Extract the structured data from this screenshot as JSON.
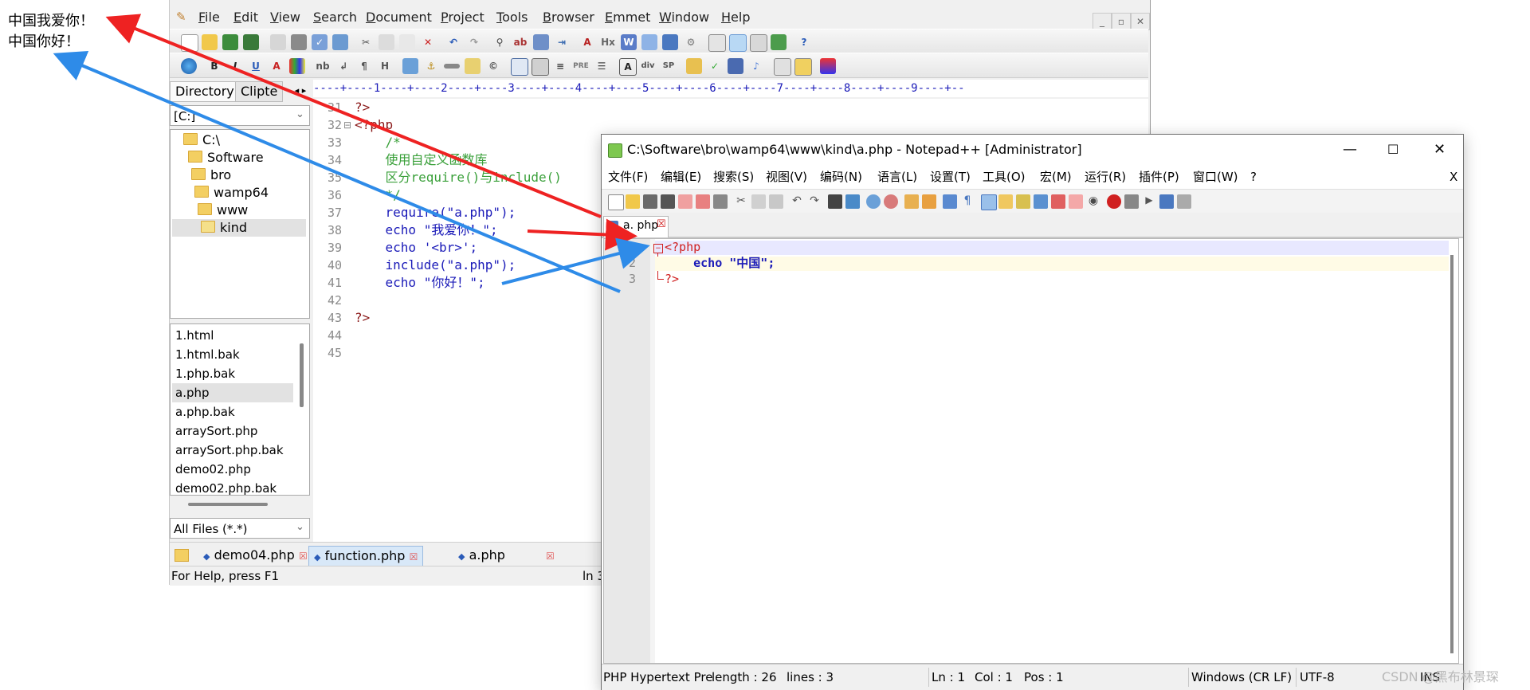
{
  "output": {
    "line1": "中国我爱你！",
    "line2": "中国你好！"
  },
  "back_window": {
    "menu": [
      "File",
      "Edit",
      "View",
      "Search",
      "Document",
      "Project",
      "Tools",
      "Browser",
      "Emmet",
      "Window",
      "Help"
    ],
    "window_controls": [
      "_",
      "▫",
      "✕"
    ],
    "panel_tabs": [
      "Directory",
      "Clipte"
    ],
    "drive": "[C:]",
    "tree": [
      "C:\\",
      "Software",
      "bro",
      "wamp64",
      "www",
      "kind"
    ],
    "files": [
      "1.html",
      "1.html.bak",
      "1.php.bak",
      "a.php",
      "a.php.bak",
      "arraySort.php",
      "arraySort.php.bak",
      "demo02.php",
      "demo02.php.bak"
    ],
    "filter": "All Files (*.*)",
    "ruler": "----+----1----+----2----+----3----+----4----+----5----+----6----+----7----+----8----+----9----+--",
    "code": [
      {
        "n": "31",
        "t": "?>"
      },
      {
        "n": "32",
        "t": "<?php"
      },
      {
        "n": "33",
        "t": "    /*"
      },
      {
        "n": "34",
        "t": "    使用自定义函数库"
      },
      {
        "n": "35",
        "t": "    区分require()与include()"
      },
      {
        "n": "36",
        "t": "    */"
      },
      {
        "n": "37",
        "t": "    require(\"a.php\");"
      },
      {
        "n": "38",
        "t": "    echo \"我爱你！\";"
      },
      {
        "n": "39",
        "t": "    echo '<br>';"
      },
      {
        "n": "40",
        "t": "    include(\"a.php\");"
      },
      {
        "n": "41",
        "t": "    echo \"你好！\";"
      },
      {
        "n": "42",
        "t": ""
      },
      {
        "n": "43",
        "t": "?>"
      },
      {
        "n": "44",
        "t": ""
      },
      {
        "n": "45",
        "t": ""
      }
    ],
    "doc_tabs": [
      "demo04.php",
      "function.php",
      "a.php"
    ],
    "status": "For Help, press F1",
    "status_right": "ln 3"
  },
  "npp": {
    "title": "C:\\Software\\bro\\wamp64\\www\\kind\\a.php - Notepad++ [Administrator]",
    "menu": [
      "文件(F)",
      "编辑(E)",
      "搜索(S)",
      "视图(V)",
      "编码(N)",
      "语言(L)",
      "设置(T)",
      "工具(O)",
      "宏(M)",
      "运行(R)",
      "插件(P)",
      "窗口(W)",
      "?"
    ],
    "close_x": "X",
    "tab": "a. php",
    "code": [
      {
        "n": "1",
        "t": "<?php"
      },
      {
        "n": "2",
        "t": "    echo \"中国\";"
      },
      {
        "n": "3",
        "t": "?>"
      }
    ],
    "status": {
      "type": "PHP Hypertext Pre",
      "length": "length : 26",
      "lines": "lines : 3",
      "ln": "Ln : 1",
      "col": "Col : 1",
      "pos": "Pos : 1",
      "eol": "Windows (CR LF)",
      "enc": "UTF-8",
      "ins": "INS"
    }
  },
  "watermark": "CSDN @黑布林景琛",
  "arrow_colors": {
    "red": "#ee2222",
    "blue": "#2e8be8"
  }
}
